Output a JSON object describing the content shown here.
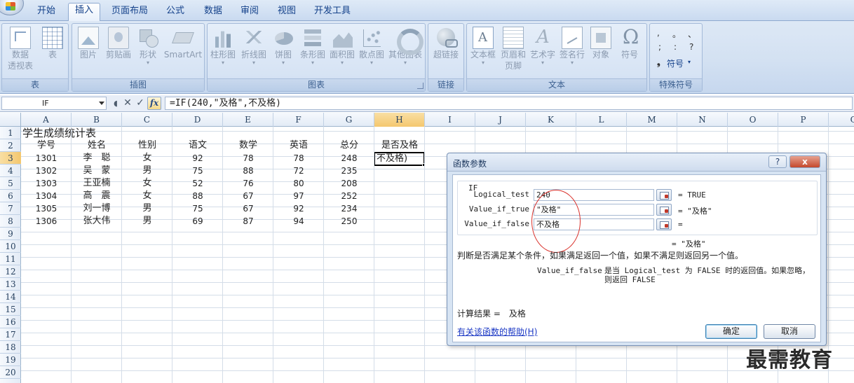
{
  "tabs": [
    {
      "label": "开始"
    },
    {
      "label": "插入"
    },
    {
      "label": "页面布局"
    },
    {
      "label": "公式"
    },
    {
      "label": "数据"
    },
    {
      "label": "审阅"
    },
    {
      "label": "视图"
    },
    {
      "label": "开发工具"
    }
  ],
  "active_tab": "插入",
  "ribbon": {
    "groups": {
      "table": {
        "label": "表",
        "pivot_line1": "数据",
        "pivot_line2": "透视表",
        "table": "表"
      },
      "illustrations": {
        "label": "插图",
        "picture": "图片",
        "clipart": "剪贴画",
        "shapes": "形状",
        "smartart": "SmartArt"
      },
      "charts": {
        "label": "图表",
        "column": "柱形图",
        "line": "折线图",
        "pie": "饼图",
        "bar": "条形图",
        "area": "面积图",
        "scatter": "散点图",
        "other": "其他图表"
      },
      "links": {
        "label": "链接",
        "hyperlink": "超链接"
      },
      "text": {
        "label": "文本",
        "textbox": "文本框",
        "header_line1": "页眉和",
        "header_line2": "页脚",
        "wordart": "艺术字",
        "signature": "签名行",
        "object": "对象",
        "symbol": "符号"
      },
      "special": {
        "label": "特殊符号",
        "s1": ",",
        "s2": "。",
        "s3": "、",
        "s4": ";",
        "s5": ":",
        "s6": "?",
        "symbol": "符号"
      }
    }
  },
  "formula_bar": {
    "name_box": "IF",
    "formula": "=IF(240,\"及格\",不及格)"
  },
  "columns": [
    "A",
    "B",
    "C",
    "D",
    "E",
    "F",
    "G",
    "H",
    "I",
    "J",
    "K",
    "L",
    "M",
    "N",
    "O",
    "P",
    "Q"
  ],
  "selected_column": "H",
  "rows": [
    "1",
    "2",
    "3",
    "4",
    "5",
    "6",
    "7",
    "8",
    "9",
    "10",
    "11",
    "12",
    "13",
    "14",
    "15",
    "16",
    "17",
    "18",
    "19",
    "20"
  ],
  "selected_row": "3",
  "sheet": {
    "title": "学生成绩统计表",
    "headers": [
      "学号",
      "姓名",
      "性别",
      "语文",
      "数学",
      "英语",
      "总分",
      "是否及格"
    ],
    "data": [
      [
        "1301",
        "李　聪",
        "女",
        "92",
        "78",
        "78",
        "248"
      ],
      [
        "1302",
        "吴　蒙",
        "男",
        "75",
        "88",
        "72",
        "235"
      ],
      [
        "1303",
        "王亚楠",
        "女",
        "52",
        "76",
        "80",
        "208"
      ],
      [
        "1304",
        "高　震",
        "女",
        "88",
        "67",
        "97",
        "252"
      ],
      [
        "1305",
        "刘一博",
        "男",
        "75",
        "67",
        "92",
        "234"
      ],
      [
        "1306",
        "张大伟",
        "男",
        "69",
        "87",
        "94",
        "250"
      ]
    ],
    "active_cell_value": "不及格)"
  },
  "dialog": {
    "title": "函数参数",
    "function_name": "IF",
    "args": [
      {
        "label": "Logical_test",
        "value": "240",
        "result": "=  TRUE"
      },
      {
        "label": "Value_if_true",
        "value": "\"及格\"",
        "result": "=  \"及格\""
      },
      {
        "label": "Value_if_false",
        "value": "不及格",
        "result": "="
      }
    ],
    "formula_result": "=  \"及格\"",
    "description": "判断是否满足某个条件，如果满足返回一个值，如果不满足则返回另一个值。",
    "arg_desc_name": "Value_if_false",
    "arg_desc_text": "是当 Logical_test 为 FALSE 时的返回值。如果忽略，则返回 FALSE",
    "calc_result": "计算结果 =　及格",
    "help_link": "有关该函数的帮助(H)",
    "ok": "确定",
    "cancel": "取消",
    "help_button": "?",
    "close_button": "x"
  },
  "watermark": "最需教育"
}
